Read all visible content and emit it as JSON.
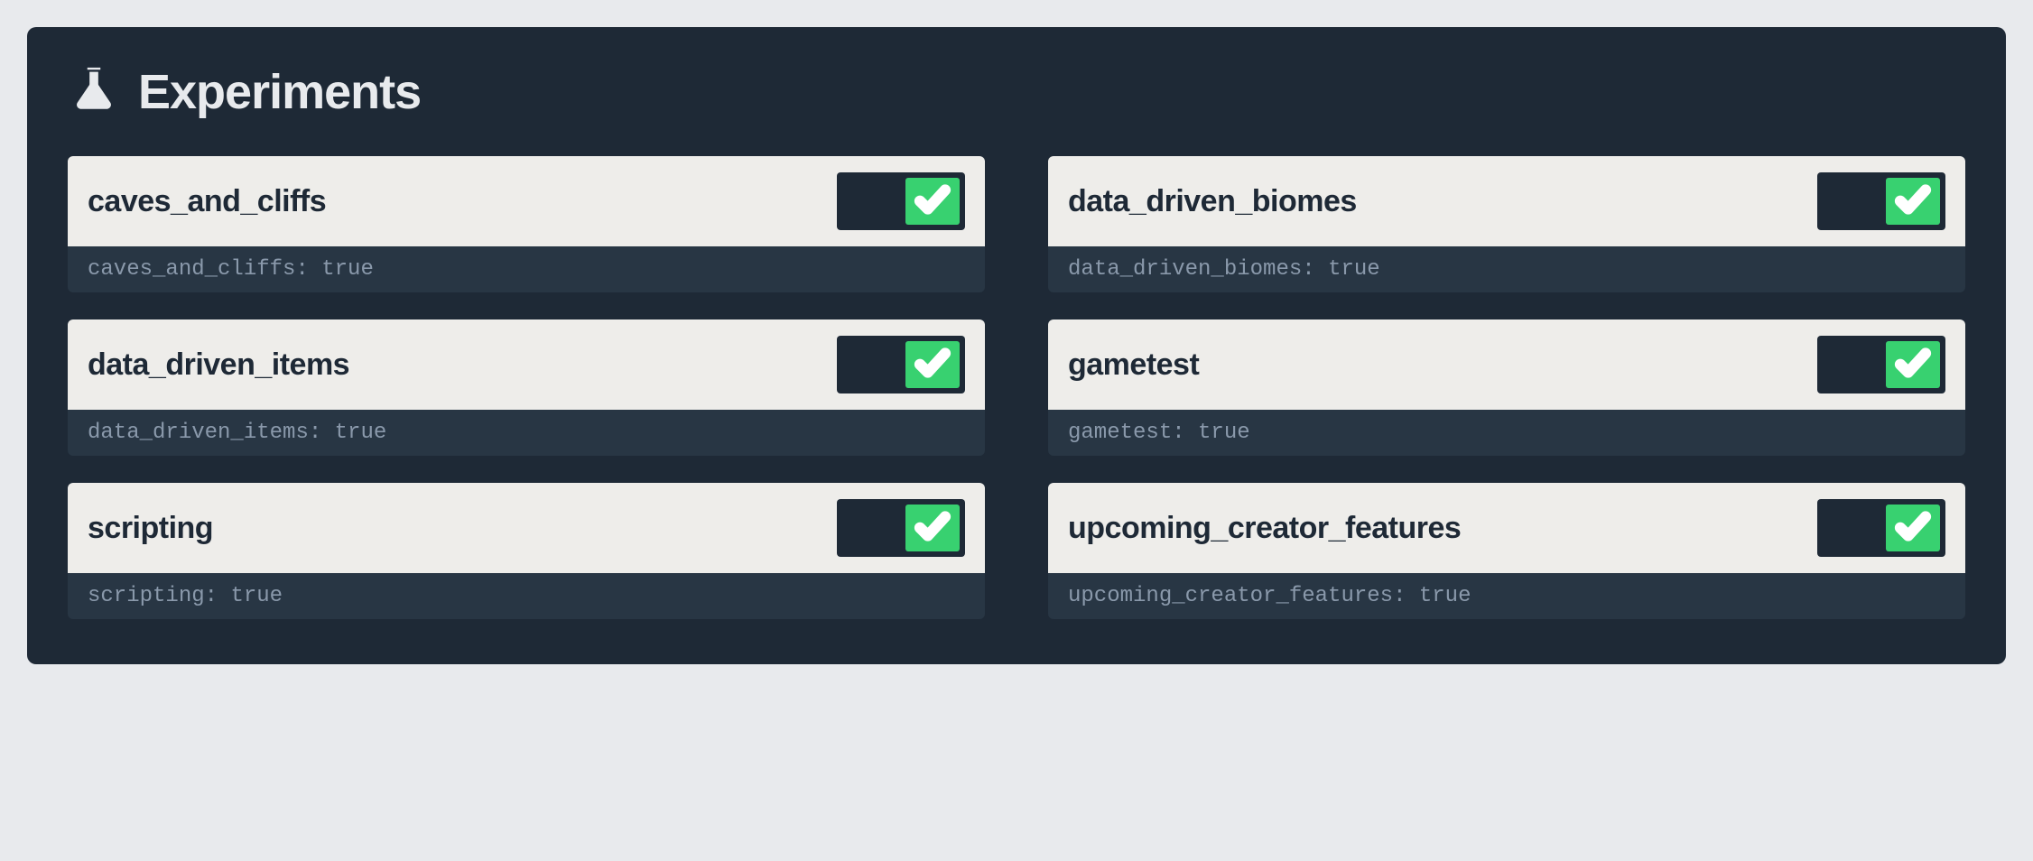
{
  "panel": {
    "title": "Experiments"
  },
  "experiments": [
    {
      "label": "caves_and_cliffs",
      "status_key": "caves_and_cliffs",
      "status_value": "true",
      "enabled": true
    },
    {
      "label": "data_driven_biomes",
      "status_key": "data_driven_biomes",
      "status_value": "true",
      "enabled": true
    },
    {
      "label": "data_driven_items",
      "status_key": "data_driven_items",
      "status_value": "true",
      "enabled": true
    },
    {
      "label": "gametest",
      "status_key": "gametest",
      "status_value": "true",
      "enabled": true
    },
    {
      "label": "scripting",
      "status_key": "scripting",
      "status_value": "true",
      "enabled": true
    },
    {
      "label": "upcoming_creator_features",
      "status_key": "upcoming_creator_features",
      "status_value": "true",
      "enabled": true
    }
  ],
  "colors": {
    "panel_bg": "#1e2936",
    "row_bg": "#eeedea",
    "status_bg": "#283644",
    "toggle_bg": "#1e2936",
    "toggle_knob": "#38d170",
    "text_light": "#e8eaed",
    "text_dark": "#1e2936",
    "text_muted": "#8a99ab"
  }
}
